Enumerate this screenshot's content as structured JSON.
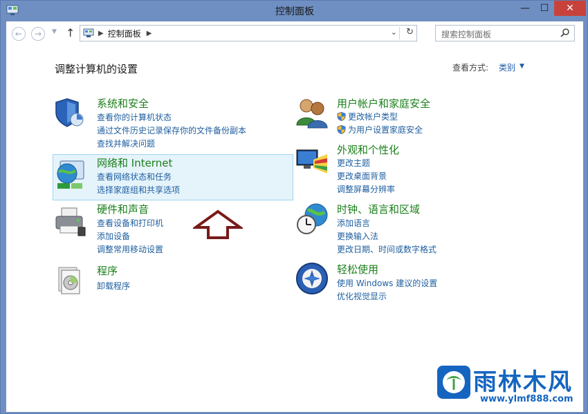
{
  "window": {
    "title": "控制面板"
  },
  "nav": {
    "breadcrumb": "控制面板",
    "search_placeholder": "搜索控制面板"
  },
  "header": {
    "title": "调整计算机的设置",
    "viewby_label": "查看方式:",
    "viewby_value": "类别"
  },
  "categories": [
    {
      "title": "系统和安全",
      "links": [
        "查看你的计算机状态",
        "通过文件历史记录保存你的文件备份副本",
        "查找并解决问题"
      ]
    },
    {
      "title": "网络和 Internet",
      "links": [
        "查看网络状态和任务",
        "选择家庭组和共享选项"
      ]
    },
    {
      "title": "硬件和声音",
      "links": [
        "查看设备和打印机",
        "添加设备",
        "调整常用移动设置"
      ]
    },
    {
      "title": "程序",
      "links": [
        "卸载程序"
      ]
    },
    {
      "title": "用户帐户和家庭安全",
      "links": [
        "更改帐户类型",
        "为用户设置家庭安全"
      ]
    },
    {
      "title": "外观和个性化",
      "links": [
        "更改主题",
        "更改桌面背景",
        "调整屏幕分辨率"
      ]
    },
    {
      "title": "时钟、语言和区域",
      "links": [
        "添加语言",
        "更换输入法",
        "更改日期、时间或数字格式"
      ]
    },
    {
      "title": "轻松使用",
      "links": [
        "使用 Windows 建议的设置",
        "优化视觉显示"
      ]
    }
  ],
  "watermark": {
    "title": "雨林木风",
    "url": "www.ylmf888.com"
  },
  "colors": {
    "title_bar": "#6f8fc2",
    "category_title": "#1a7f1a",
    "link": "#1f5fa0",
    "highlight": "#e5f3fb",
    "arrow": "#7a1a1a",
    "watermark": "#1565c0"
  }
}
